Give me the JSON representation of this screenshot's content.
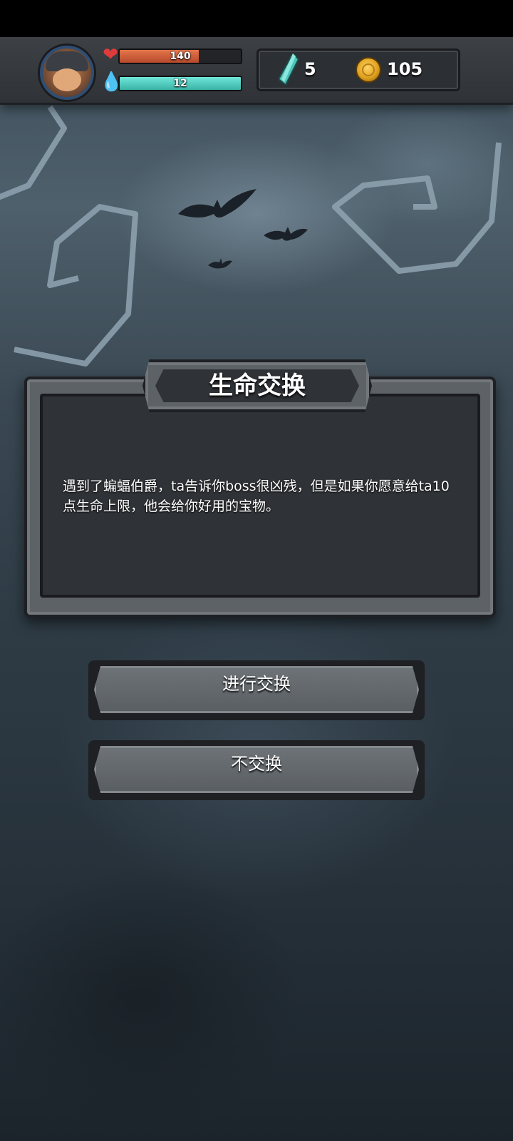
{
  "player": {
    "hp": {
      "value": 140,
      "max": 140,
      "label": "140",
      "fill_fraction": 0.65
    },
    "mp": {
      "value": 12,
      "max": 12,
      "label": "12",
      "fill_fraction": 1.0
    }
  },
  "currency": {
    "gems": "5",
    "coins": "105"
  },
  "event": {
    "title": "生命交换",
    "description": "遇到了蝙蝠伯爵，ta告诉你boss很凶残，但是如果你愿意给ta10点生命上限，他会给你好用的宝物。"
  },
  "choices": {
    "accept_label": "进行交换",
    "decline_label": "不交换"
  },
  "icons": {
    "hp": "heart-icon",
    "mp": "mana-flame-icon",
    "gem": "crystal-icon",
    "coin": "gold-coin-icon",
    "avatar": "player-avatar"
  },
  "colors": {
    "hp_bar": "#d35f3a",
    "mp_bar": "#55d3c5",
    "panel": "#2f3236",
    "frame": "#5d6266"
  }
}
